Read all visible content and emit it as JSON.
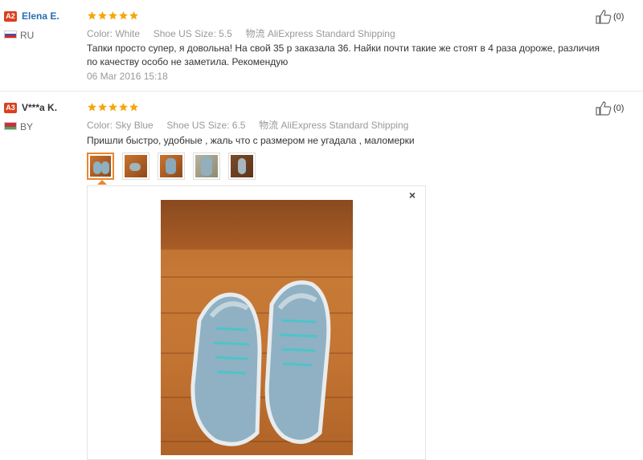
{
  "reviews": [
    {
      "badge": "A2",
      "name": "Elena E.",
      "country": "RU",
      "flag_colors": [
        "#ffffff",
        "#2b57c6",
        "#d52b1e"
      ],
      "stars": 5,
      "star_color": "#f5a70b",
      "color_label": "Color:",
      "color_value": "White",
      "size_label": "Shoe US Size:",
      "size_value": "5.5",
      "shipping_label": "物流",
      "shipping_value": "AliExpress Standard Shipping",
      "text": "Тапки просто супер, я довольна! На свой 35 р заказала 36. Найки почти такие же стоят в 4 раза дороже, различия по качеству особо не заметила. Рекомендую",
      "date": "06 Mar 2016 15:18",
      "likes": "(0)"
    },
    {
      "badge": "A3",
      "name": "V***a K.",
      "country": "BY",
      "flag_colors": [
        "#c8313e",
        "#c8313e",
        "#4aa657"
      ],
      "stars": 5,
      "star_color": "#f5a70b",
      "color_label": "Color:",
      "color_value": "Sky Blue",
      "size_label": "Shoe US Size:",
      "size_value": "6.5",
      "shipping_label": "物流",
      "shipping_value": "AliExpress Standard Shipping",
      "text": "Пришли быстро, удобные , жаль что с размером не угадала , маломерки",
      "likes": "(0)",
      "photo_count": 5,
      "close_label": "×"
    }
  ],
  "accent_color": "#e9872d",
  "icons": {
    "like": "thumbs-up-icon",
    "close": "close-icon",
    "star": "star-icon"
  }
}
